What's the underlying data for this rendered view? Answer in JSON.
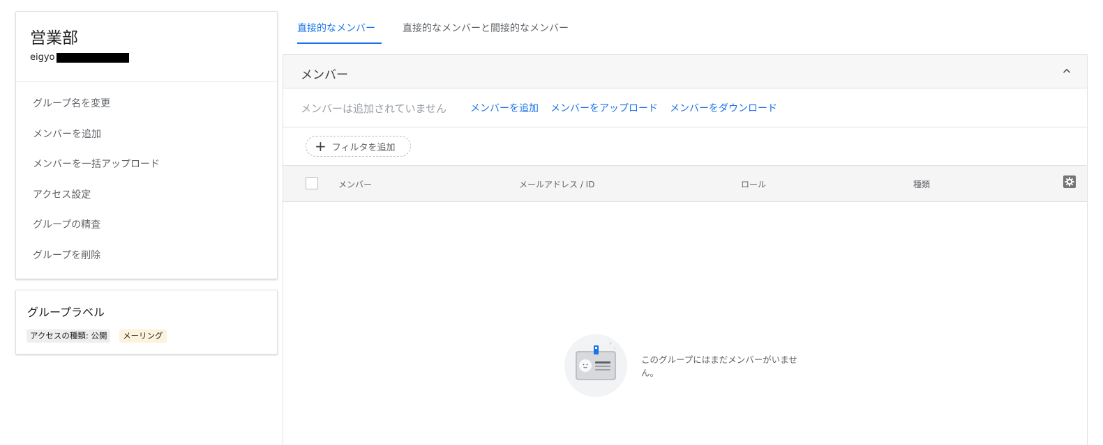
{
  "group": {
    "title": "営業部",
    "email_prefix": "eigyo"
  },
  "sidebar_menu": {
    "items": [
      {
        "label": "グループ名を変更"
      },
      {
        "label": "メンバーを追加"
      },
      {
        "label": "メンバーを一括アップロード"
      },
      {
        "label": "アクセス設定"
      },
      {
        "label": "グループの精査"
      },
      {
        "label": "グループを削除"
      }
    ]
  },
  "labels": {
    "title": "グループラベル",
    "chips": [
      "アクセスの種類: 公開",
      "メーリング"
    ]
  },
  "tabs": [
    {
      "label": "直接的なメンバー",
      "active": true
    },
    {
      "label": "直接的なメンバーと間接的なメンバー",
      "active": false
    }
  ],
  "members_panel": {
    "title": "メンバー",
    "no_members_text": "メンバーは追加されていません",
    "actions": [
      "メンバーを追加",
      "メンバーをアップロード",
      "メンバーをダウンロード"
    ],
    "filter_label": "フィルタを追加",
    "columns": [
      "メンバー",
      "メールアドレス / ID",
      "ロール",
      "種類"
    ],
    "empty_state_text": "このグループにはまだメンバーがいません。"
  },
  "colors": {
    "accent": "#1a73e8",
    "mailing_chip_bg": "#fdf3dc",
    "access_chip_bg": "#eeeeee"
  },
  "icons": [
    "collapse-chevron-up-icon",
    "plus-icon",
    "settings-gear-icon",
    "id-card-illustration"
  ]
}
